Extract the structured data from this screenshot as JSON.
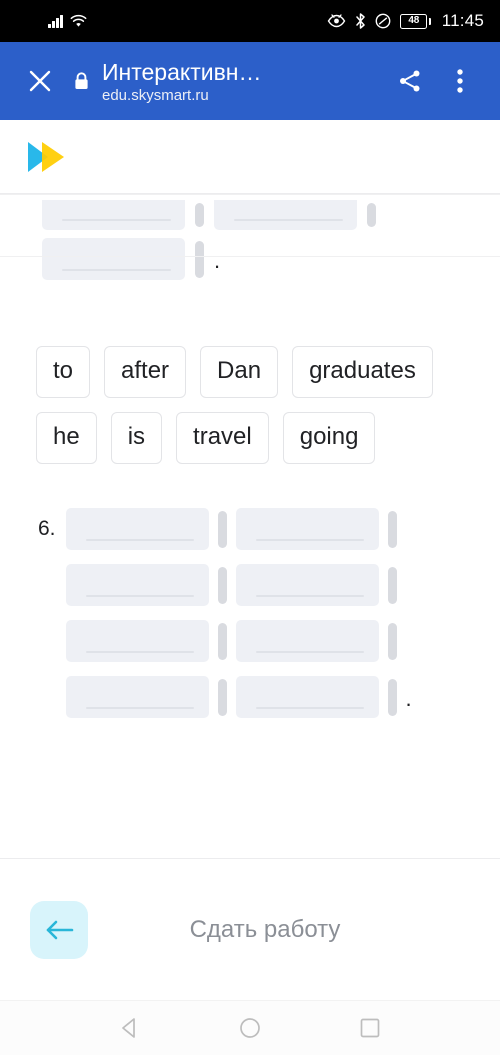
{
  "status_bar": {
    "signal_icon": "cellular-signal-icon",
    "wifi_icon": "wifi-icon",
    "eye_comfort_icon": "eye-comfort-icon",
    "bluetooth_icon": "bluetooth-icon",
    "dnd_icon": "do-not-disturb-icon",
    "battery_percent": "48",
    "time": "11:45"
  },
  "browser_toolbar": {
    "close_label": "✕",
    "lock_icon": "lock-icon",
    "title": "Интерактивн…",
    "url": "edu.skysmart.ru",
    "share_icon": "share-icon",
    "menu_icon": "more-vertical-icon",
    "background_color": "#2c5fc9"
  },
  "brand": {
    "logo_name": "skysmart-logo",
    "logo_color_primary": "#29b8ea",
    "logo_color_secondary": "#ffcc00"
  },
  "exercise": {
    "partial_question": {
      "slots_row_1": 2,
      "slots_row_2": 1,
      "trailing_period": "."
    },
    "word_bank": {
      "chips": [
        "to",
        "after",
        "Dan",
        "graduates",
        "he",
        "is",
        "travel",
        "going"
      ]
    },
    "question_6": {
      "number_label": "6.",
      "empty_slot_count": 8,
      "slots_per_row": 2,
      "trailing_period": "."
    },
    "slot_color": "#eef0f5",
    "caret_color": "#d9dbe0"
  },
  "action_bar": {
    "back_icon": "arrow-left-icon",
    "back_button_color": "#d8f4fb",
    "back_arrow_color": "#29b6d8",
    "submit_label": "Сдать работу",
    "submit_label_color": "#8b8f96"
  },
  "android_nav": {
    "back_icon": "nav-back-triangle-icon",
    "home_icon": "nav-home-circle-icon",
    "recents_icon": "nav-recents-square-icon"
  }
}
